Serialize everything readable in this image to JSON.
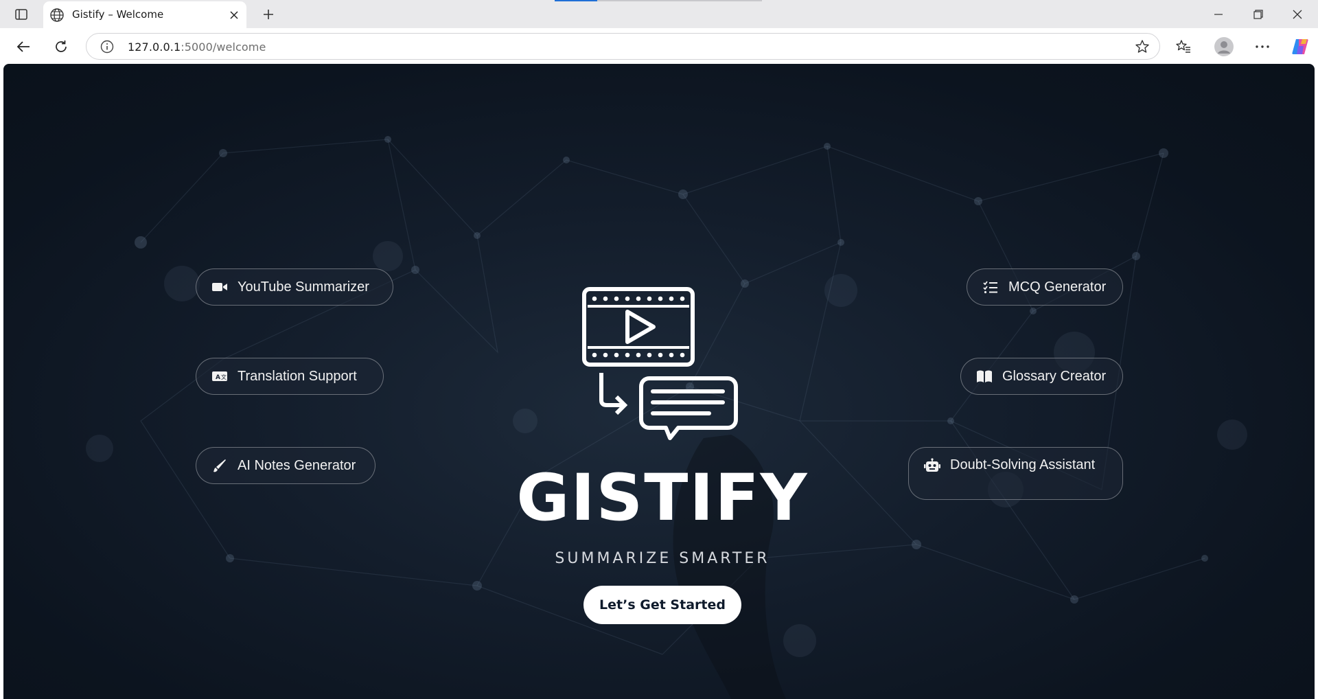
{
  "browser": {
    "tab_title": "Gistify – Welcome",
    "url_host": "127.0.0.1",
    "url_rest": ":5000/welcome"
  },
  "icons": {
    "tab_actions": "tab-actions-icon",
    "favicon": "globe-icon",
    "close_tab": "close-icon",
    "new_tab": "plus-icon",
    "back": "back-arrow-icon",
    "refresh": "refresh-icon",
    "site_info": "info-icon",
    "favorite": "star-icon",
    "favorites": "favorites-icon",
    "profile": "avatar-icon",
    "menu": "more-icon",
    "copilot": "copilot-icon"
  },
  "features_left": [
    {
      "label": "YouTube Summarizer",
      "icon": "video-camera-icon"
    },
    {
      "label": "Translation Support",
      "icon": "language-icon"
    },
    {
      "label": "AI Notes Generator",
      "icon": "pen-icon"
    }
  ],
  "features_right": [
    {
      "label": "MCQ Generator",
      "icon": "checklist-icon"
    },
    {
      "label": "Glossary Creator",
      "icon": "book-icon"
    },
    {
      "label": "Doubt-Solving Assistant",
      "icon": "robot-icon"
    }
  ],
  "hero": {
    "brand": "GISTIFY",
    "tagline": "SUMMARIZE SMARTER",
    "cta_label": "Let’s Get Started",
    "logo_icon": "video-to-chat-logo-icon"
  },
  "colors": {
    "background": "#0c141f",
    "pill_border": "#5a6270",
    "cta_background": "#ffffff",
    "cta_text": "#0e1a2b",
    "loading_indicator": "#1f6fd6"
  }
}
